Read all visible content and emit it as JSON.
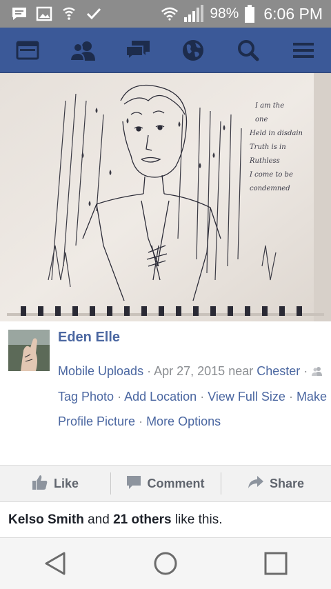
{
  "status_bar": {
    "battery_percent": "98%",
    "time": "6:06 PM",
    "icons": [
      "message-icon",
      "image-icon",
      "shield-icon",
      "check-icon",
      "wifi-icon",
      "signal-icon",
      "battery-icon"
    ]
  },
  "nav": {
    "items": [
      "news-feed-icon",
      "friends-icon",
      "messages-icon",
      "globe-icon",
      "search-icon",
      "menu-icon"
    ],
    "bg_color": "#3b5998"
  },
  "photo": {
    "handwritten_lines": [
      "I am the",
      "one",
      "Held in disdain",
      "Truth is in",
      "Ruthless",
      "I come to be",
      "condemned"
    ]
  },
  "post": {
    "author": "Eden Elle",
    "album": "Mobile Uploads",
    "date": "Apr 27, 2015",
    "near_label": "near",
    "location": "Chester",
    "options": [
      "Tag Photo",
      "Add Location",
      "View Full Size",
      "Make Profile Picture",
      "More Options"
    ]
  },
  "actions": {
    "like": "Like",
    "comment": "Comment",
    "share": "Share"
  },
  "likes": {
    "name": "Kelso Smith",
    "and": "and",
    "others": "21 others",
    "suffix": "like this."
  },
  "android_nav": [
    "back-icon",
    "home-icon",
    "recents-icon"
  ]
}
